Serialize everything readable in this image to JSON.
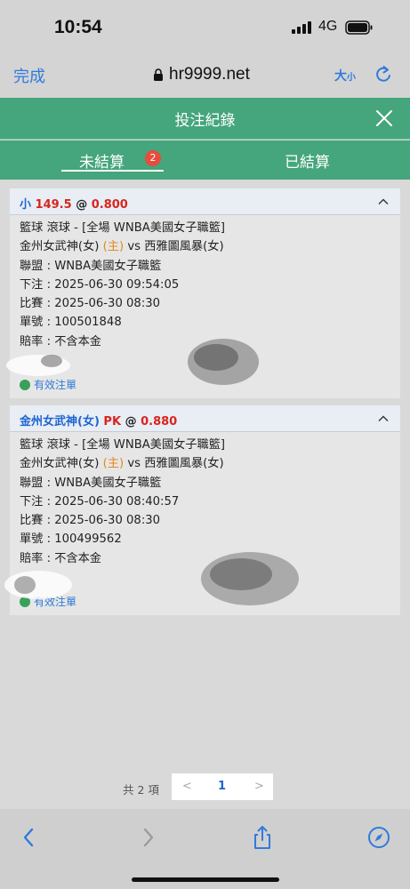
{
  "status_bar": {
    "time": "10:54",
    "network": "4G"
  },
  "safari": {
    "done_label": "完成",
    "url": "hr9999.net",
    "text_size_big": "大",
    "text_size_small": "小"
  },
  "header": {
    "title": "投注紀錄"
  },
  "tabs": [
    {
      "label": "未結算",
      "badge": "2",
      "active": true
    },
    {
      "label": "已結算",
      "active": false
    }
  ],
  "bets": [
    {
      "head_pick": "小",
      "head_line": "149.5",
      "head_at": "@",
      "head_odds": "0.800",
      "sport_line": "籃球 滾球 - [全場 WNBA美國女子職籃]",
      "home_team": "金州女武神(女)",
      "home_tag": "(主)",
      "vs": "vs",
      "away_team": "西雅圖風暴(女)",
      "league": "聯盟 : WNBA美國女子職籃",
      "bet_time": "下注 : 2025-06-30 09:54:05",
      "match_time": "比賽 : 2025-06-30 08:30",
      "ticket": "單號 : 100501848",
      "odds_type": "賠率 : 不含本金",
      "status": "有效注單"
    },
    {
      "head_pick": "金州女武神(女)",
      "head_line": "PK",
      "head_at": "@",
      "head_odds": "0.880",
      "sport_line": "籃球 滾球 - [全場 WNBA美國女子職籃]",
      "home_team": "金州女武神(女)",
      "home_tag": "(主)",
      "vs": "vs",
      "away_team": "西雅圖風暴(女)",
      "league": "聯盟 : WNBA美國女子職籃",
      "bet_time": "下注 : 2025-06-30 08:40:57",
      "match_time": "比賽 : 2025-06-30 08:30",
      "ticket": "單號 : 100499562",
      "odds_type": "賠率 : 不含本金",
      "status": "有效注單"
    }
  ],
  "pager": {
    "total": "共 2 項",
    "prev": "<",
    "current": "1",
    "next": ">"
  },
  "colors": {
    "header_green": "#45a57c",
    "link_blue": "#2f7bdc",
    "odds_red": "#d7261e",
    "home_orange": "#e28a1f"
  }
}
